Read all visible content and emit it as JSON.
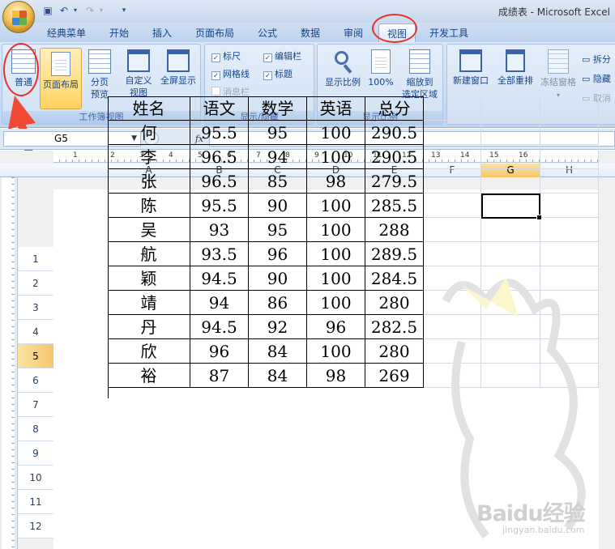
{
  "window": {
    "title": "成绩表 - Microsoft Excel"
  },
  "tabs": [
    "经典菜单",
    "开始",
    "插入",
    "页面布局",
    "公式",
    "数据",
    "审阅",
    "视图",
    "开发工具"
  ],
  "active_tab": "视图",
  "ribbon": {
    "workbook_views": {
      "label": "工作簿视图",
      "normal": "普通",
      "page_layout": "页面布局",
      "page_break_1": "分页",
      "page_break_2": "预览",
      "custom_1": "自定义",
      "custom_2": "视图",
      "fullscreen": "全屏显示"
    },
    "show_hide": {
      "label": "显示/隐藏",
      "ruler": "标尺",
      "formula_bar": "编辑栏",
      "gridlines": "网格线",
      "headings": "标题",
      "message_bar": "消息栏"
    },
    "zoom": {
      "label": "显示比例",
      "zoom": "显示比例",
      "hundred": "100%",
      "fit_1": "缩放到",
      "fit_2": "选定区域"
    },
    "window": {
      "new_window": "新建窗口",
      "arrange_all": "全部重排",
      "freeze": "冻结窗格",
      "split": "拆分",
      "hide": "隐藏",
      "unhide": "取消"
    }
  },
  "formula_bar": {
    "name_box": "G5",
    "fx": "fx",
    "content": ""
  },
  "ruler_numbers": [
    "1",
    "2",
    "3",
    "4",
    "5",
    "6",
    "7",
    "8",
    "9",
    "10",
    "11",
    "12",
    "13",
    "14",
    "15",
    "16"
  ],
  "columns": [
    "A",
    "B",
    "C",
    "D",
    "E",
    "F",
    "G",
    "H"
  ],
  "selected_column": "G",
  "rows": [
    "1",
    "2",
    "3",
    "4",
    "5",
    "6",
    "7",
    "8",
    "9",
    "10",
    "11",
    "12"
  ],
  "selected_row": "5",
  "table": {
    "headers": [
      "姓名",
      "语文",
      "数学",
      "英语",
      "总分"
    ],
    "rows": [
      [
        "何",
        "95.5",
        "95",
        "100",
        "290.5"
      ],
      [
        "李",
        "96.5",
        "94",
        "100",
        "290.5"
      ],
      [
        "张",
        "96.5",
        "85",
        "98",
        "279.5"
      ],
      [
        "陈",
        "95.5",
        "90",
        "100",
        "285.5"
      ],
      [
        "吴",
        "93",
        "95",
        "100",
        "288"
      ],
      [
        "航",
        "93.5",
        "96",
        "100",
        "289.5"
      ],
      [
        "颖",
        "94.5",
        "90",
        "100",
        "284.5"
      ],
      [
        "靖",
        "94",
        "86",
        "100",
        "280"
      ],
      [
        "丹",
        "94.5",
        "92",
        "96",
        "282.5"
      ],
      [
        "欣",
        "96",
        "84",
        "100",
        "280"
      ],
      [
        "裕",
        "87",
        "84",
        "98",
        "269"
      ]
    ]
  },
  "watermark": {
    "brand": "Baidu经验",
    "url": "jingyan.baidu.com"
  },
  "colors": {
    "annotation_red": "#e8312a",
    "selection_gold": "#f5c56b",
    "ribbon_blue": "#15428b"
  }
}
